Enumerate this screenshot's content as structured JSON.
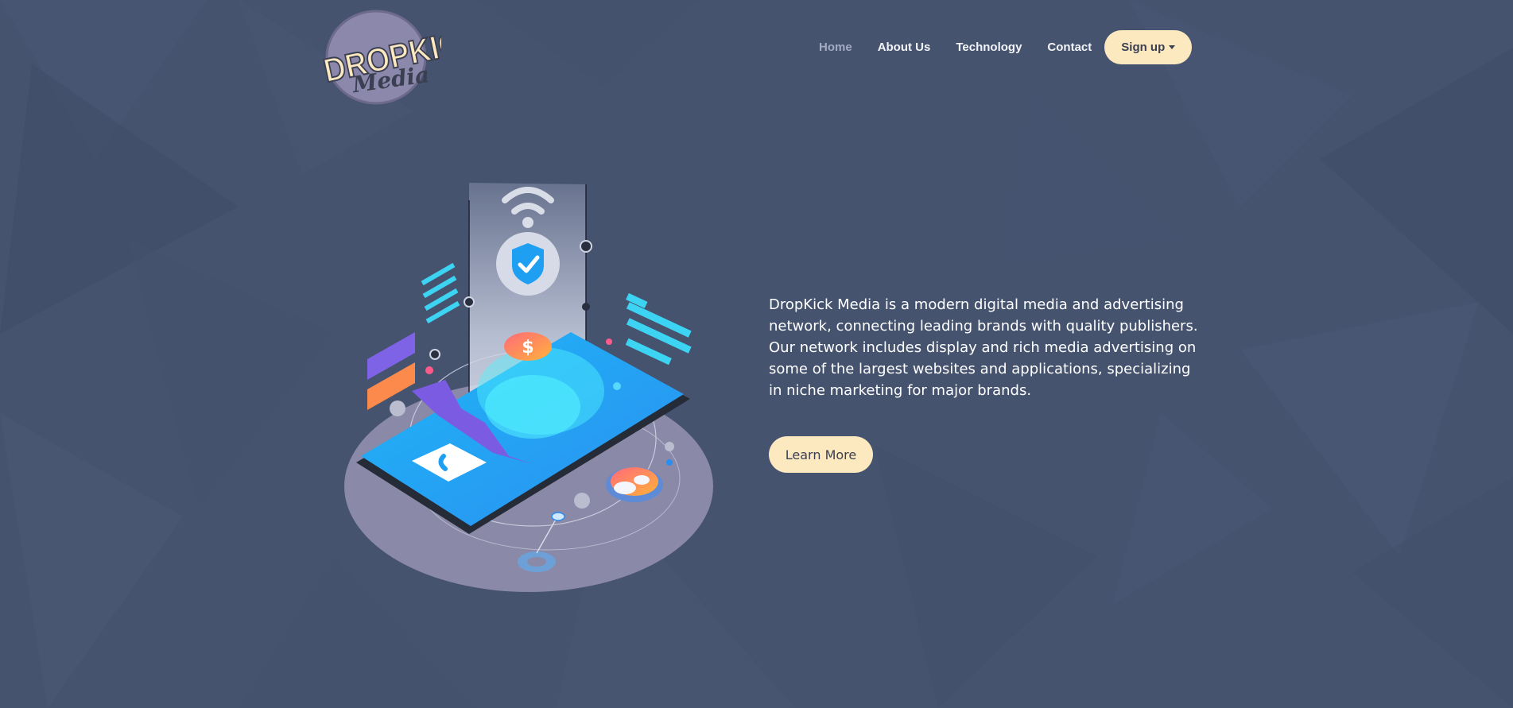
{
  "brand": {
    "logo_line1": "DROPKICK",
    "logo_line2": "Media"
  },
  "nav": {
    "items": [
      {
        "label": "Home",
        "active": true
      },
      {
        "label": "About Us",
        "active": false
      },
      {
        "label": "Technology",
        "active": false
      },
      {
        "label": "Contact",
        "active": false
      }
    ],
    "signup_label": "Sign up"
  },
  "hero": {
    "description": "DropKick Media is a modern digital media and advertising network, connecting leading brands with quality publishers. Our network includes display and rich media advertising on some of the largest websites and applications, specializing in niche marketing for major brands.",
    "cta_label": "Learn More",
    "dollar_symbol": "$"
  },
  "icons": {
    "wifi": "wifi-icon",
    "shield": "shield-check-icon",
    "phone_call": "phone-call-icon",
    "dollar_coin": "dollar-coin-icon",
    "user_group": "user-group-icon",
    "caret": "caret-down-icon"
  },
  "colors": {
    "background": "#45536f",
    "button_bg": "#fde9bf",
    "button_text": "#3a3f52",
    "nav_text": "#f3f4f7",
    "nav_active": "#a3aac2",
    "accent_cyan": "#2ec6f5",
    "platform": "#8a89a8"
  }
}
